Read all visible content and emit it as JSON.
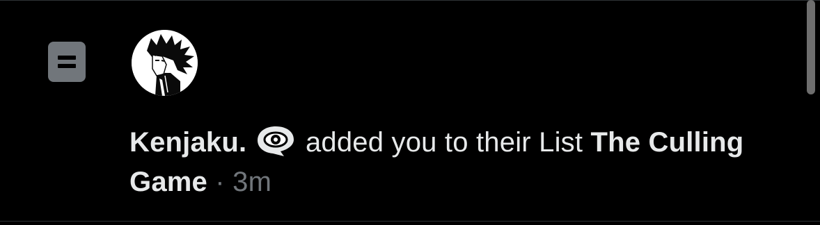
{
  "notification": {
    "type_icon": "list-icon",
    "avatar_icon": "avatar-portrait-icon",
    "user_name": "Kenjaku.",
    "name_emoji": "eye-in-speech-bubble-icon",
    "action_text": " added you to their List ",
    "list_name": "The Culling Game",
    "separator": " · ",
    "time": "3m"
  },
  "colors": {
    "background": "#000000",
    "primary_text": "#e7e9ea",
    "secondary_text": "#71767b",
    "divider": "#2f3336"
  }
}
